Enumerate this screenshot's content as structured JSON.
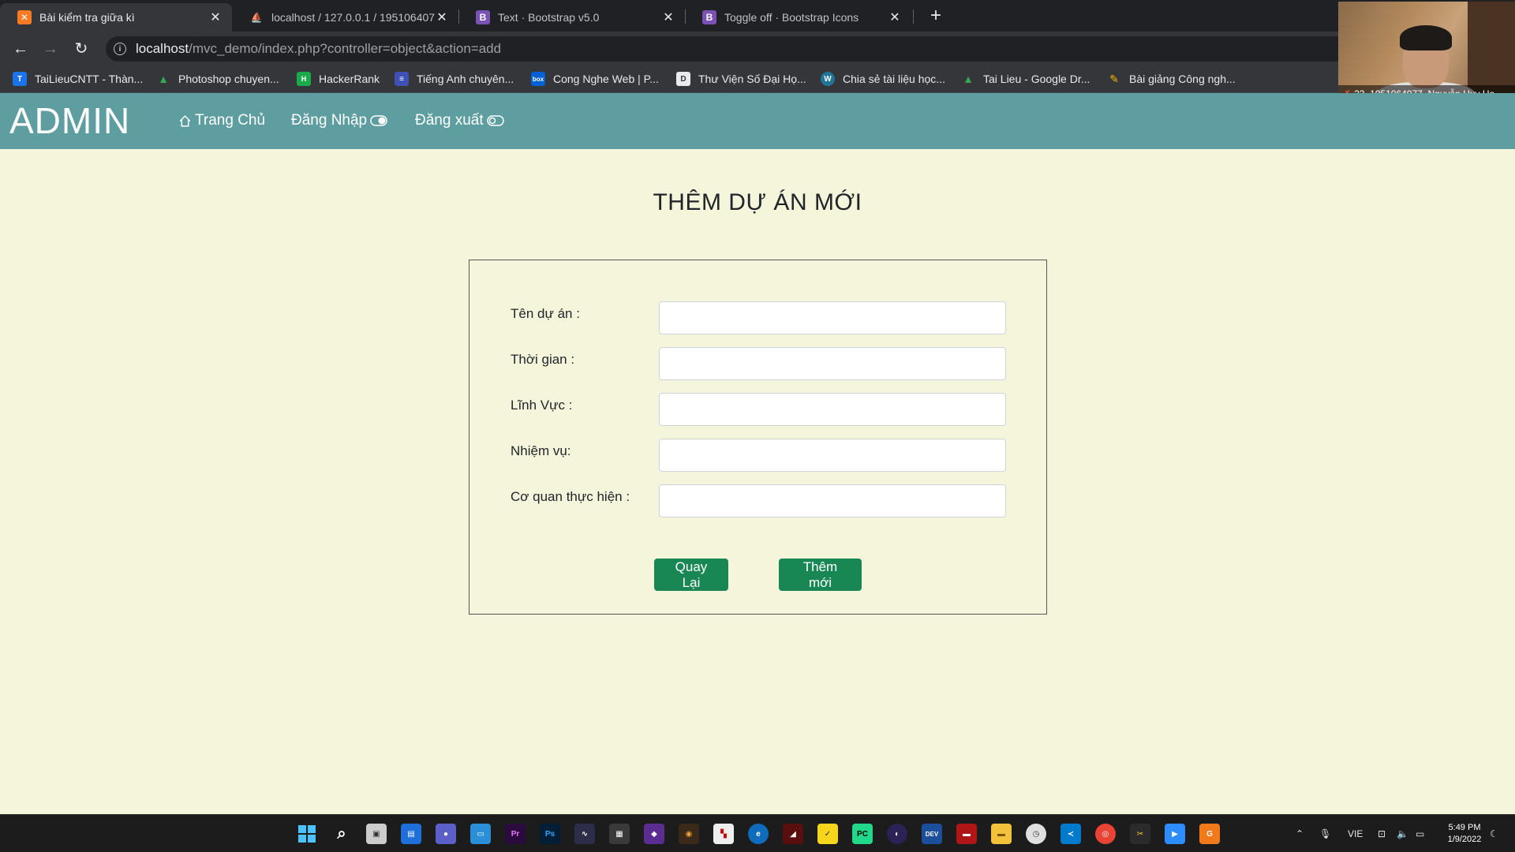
{
  "browser": {
    "tabs": [
      {
        "title": "Bài kiểm tra giữa kì",
        "favicon": "xampp-icon",
        "active": true
      },
      {
        "title": "localhost / 127.0.0.1 / 195106407",
        "favicon": "phpmyadmin-icon",
        "active": false
      },
      {
        "title": "Text · Bootstrap v5.0",
        "favicon": "bootstrap-icon",
        "active": false
      },
      {
        "title": "Toggle off · Bootstrap Icons",
        "favicon": "bootstrap-icon",
        "active": false
      }
    ],
    "url_host": "localhost",
    "url_path": "/mvc_demo/index.php?controller=object&action=add",
    "bookmarks": [
      {
        "label": "TaiLieuCNTT - Thàn...",
        "icon": "tailieu-icon",
        "color": "#1a73e8"
      },
      {
        "label": "Photoshop chuyen...",
        "icon": "google-drive-icon",
        "color": "#34a853"
      },
      {
        "label": "HackerRank",
        "icon": "hackerrank-icon",
        "color": "#1ba94c"
      },
      {
        "label": "Tiếng Anh chuyên...",
        "icon": "forms-icon",
        "color": "#3f51b5"
      },
      {
        "label": "Cong Nghe Web | P...",
        "icon": "box-icon",
        "color": "#0061d5"
      },
      {
        "label": "Thư Viện Số Đại Họ...",
        "icon": "d-icon",
        "color": "#555555"
      },
      {
        "label": "Chia sẻ tài liệu học...",
        "icon": "wordpress-icon",
        "color": "#21759b"
      },
      {
        "label": "Tai Lieu - Google Dr...",
        "icon": "google-drive-icon",
        "color": "#34a853"
      },
      {
        "label": "Bài giảng Công ngh...",
        "icon": "pencil-icon",
        "color": "#f4b400"
      }
    ]
  },
  "webcam": {
    "name": "23_1951064077_Nguyễn Huy Ho..."
  },
  "site": {
    "brand": "ADMIN",
    "nav": {
      "home": "Trang Chủ",
      "login": "Đăng Nhập",
      "logout": "Đăng xuất"
    }
  },
  "form": {
    "title": "THÊM DỰ ÁN MỚI",
    "fields": [
      {
        "label": "Tên dự án :",
        "value": ""
      },
      {
        "label": "Thời gian :",
        "value": ""
      },
      {
        "label": "Lĩnh Vực :",
        "value": ""
      },
      {
        "label": "Nhiệm vụ:",
        "value": ""
      },
      {
        "label": "Cơ quan thực hiện :",
        "value": ""
      }
    ],
    "back_button": "Quay Lại",
    "add_button": "Thêm mới",
    "button_color": "#198754"
  },
  "taskbar": {
    "language": "VIE",
    "time": "5:49 PM",
    "date": "1/9/2022"
  },
  "colors": {
    "navbar": "#5f9ea0",
    "page_bg": "#f5f5dc"
  }
}
